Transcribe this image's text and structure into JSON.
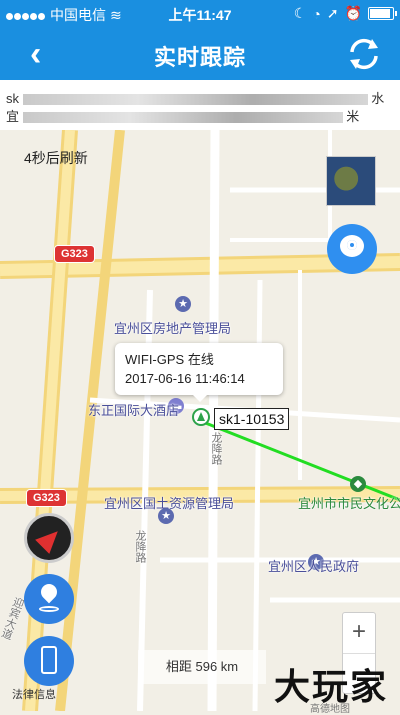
{
  "status_bar": {
    "carrier": "中国电信",
    "time": "上午11:47",
    "battery": "full"
  },
  "nav": {
    "back_icon": "chevron-left-icon",
    "title": "实时跟踪",
    "refresh_icon": "refresh-icon"
  },
  "address": {
    "line1_start": "sk",
    "line1_end": "水",
    "line2_start": "宜",
    "line2_end": "米"
  },
  "map": {
    "refresh_text": "4秒后刷新",
    "roads": {
      "g323_top": "G323",
      "g323_bottom": "G323",
      "longlong_road": "龙降路",
      "road_mid": "龙降路",
      "yingbin": "迎宾大道"
    },
    "pois": {
      "realestate": "宜州区房地产管理局",
      "hotel": "东正国际大酒店",
      "landres": "宜州区国土资源管理局",
      "culture": "宜州市市民文化公",
      "gov": "宜州区人民政府"
    },
    "popup": {
      "line1": "WIFI-GPS 在线",
      "line2": "2017-06-16 11:46:14"
    },
    "device_label": "sk1-10153",
    "distance_text": "相距 596 km",
    "legal_text": "法律信息",
    "zoom_in": "+",
    "zoom_out": "−",
    "watermark": "大玩家",
    "map_brand": "高德地图"
  },
  "colors": {
    "header": "#1a8fe0",
    "accent": "#2f8ff0",
    "track": "#22dd22"
  }
}
